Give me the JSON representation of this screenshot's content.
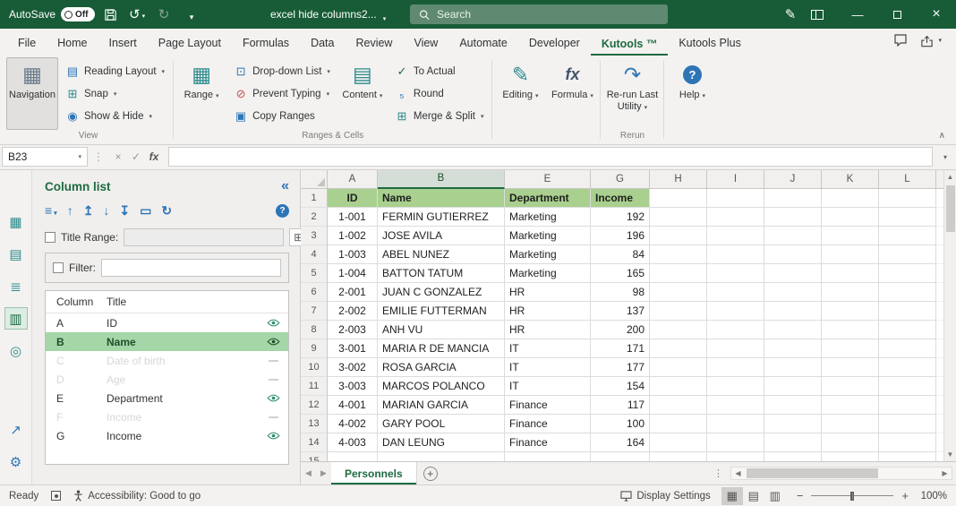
{
  "colors": {
    "titlebar_green": "#185c37",
    "accent_green": "#1e6b41",
    "header_fill_green": "#a9d08e",
    "selected_row_green": "#a4d6a7",
    "icon_blue": "#2e75b6",
    "icon_teal": "#2e8b8b"
  },
  "titlebar": {
    "autosave_label": "AutoSave",
    "autosave_state": "Off",
    "doc_title": "excel hide columns2...",
    "search_placeholder": "Search"
  },
  "ribbon_tabs": {
    "items": [
      "File",
      "Home",
      "Insert",
      "Page Layout",
      "Formulas",
      "Data",
      "Review",
      "View",
      "Automate",
      "Developer",
      "Kutools ™",
      "Kutools Plus"
    ],
    "active": "Kutools ™"
  },
  "ribbon": {
    "groups": [
      {
        "label": "View",
        "items": [
          {
            "type": "big",
            "label": "Navigation",
            "icon": "▦",
            "icon_color": "#6a7b8c",
            "selected": true,
            "caret": false
          },
          {
            "type": "col",
            "items": [
              {
                "label": "Reading Layout",
                "icon": "▤",
                "icon_color": "#2e75b6",
                "caret": true
              },
              {
                "label": "Snap",
                "icon": "⊞",
                "icon_color": "#2e8b8b",
                "caret": true
              },
              {
                "label": "Show & Hide",
                "icon": "◉",
                "icon_color": "#2e75b6",
                "caret": true
              }
            ]
          }
        ]
      },
      {
        "label": "Ranges & Cells",
        "items": [
          {
            "type": "big",
            "label": "Range",
            "icon": "▦",
            "icon_color": "#2e8b8b",
            "caret": true
          },
          {
            "type": "col",
            "items": [
              {
                "label": "Drop-down List",
                "icon": "⊡",
                "icon_color": "#2e75b6",
                "caret": true
              },
              {
                "label": "Prevent Typing",
                "icon": "⊘",
                "icon_color": "#c0504d",
                "caret": true
              },
              {
                "label": "Copy Ranges",
                "icon": "▣",
                "icon_color": "#2e75b6",
                "caret": false
              }
            ]
          },
          {
            "type": "big",
            "label": "Content",
            "icon": "▤",
            "icon_color": "#2e8b8b",
            "caret": true
          },
          {
            "type": "col",
            "items": [
              {
                "label": "To Actual",
                "icon": "✓",
                "icon_color": "#1e6b41",
                "caret": false
              },
              {
                "label": "Round",
                "icon": "₅",
                "icon_color": "#2e75b6",
                "caret": false
              },
              {
                "label": "Merge & Split",
                "icon": "⊞",
                "icon_color": "#2e8b8b",
                "caret": true
              }
            ]
          }
        ]
      },
      {
        "label": "",
        "items": [
          {
            "type": "big",
            "label": "Editing",
            "icon": "✎",
            "icon_color": "#2e8b8b",
            "caret": true
          },
          {
            "type": "big",
            "label": "Formula",
            "icon": "fx",
            "icon_color": "#44546a",
            "caret": true,
            "italic": true
          }
        ]
      },
      {
        "label": "Rerun",
        "items": [
          {
            "type": "big",
            "label": "Re-run Last Utility",
            "icon": "↷",
            "icon_color": "#2e75b6",
            "caret": true
          }
        ]
      },
      {
        "label": "",
        "items": [
          {
            "type": "big",
            "label": "Help",
            "icon": "?",
            "icon_color": "#ffffff",
            "icon_bg": "#2e75b6",
            "caret": true
          }
        ]
      }
    ]
  },
  "formula_bar": {
    "name_box": "B23",
    "fx_label": "fx"
  },
  "left_strip": {
    "top": [
      {
        "name": "navigation-pane-icon",
        "glyph": "▦"
      },
      {
        "name": "worksheet-list-icon",
        "glyph": "▤"
      },
      {
        "name": "resources-library-icon",
        "glyph": "≣"
      },
      {
        "name": "column-list-icon",
        "glyph": "▥",
        "active": true
      },
      {
        "name": "advanced-find-icon",
        "glyph": "◎"
      }
    ],
    "bottom": [
      {
        "name": "expand-pane-icon",
        "glyph": "↗"
      },
      {
        "name": "settings-gear-icon",
        "glyph": "⚙"
      }
    ]
  },
  "pane": {
    "title": "Column list",
    "collapse_glyph": "«",
    "toolbar": [
      {
        "name": "list-menu-icon",
        "glyph": "≡",
        "caret": true
      },
      {
        "name": "move-up-icon",
        "glyph": "↑"
      },
      {
        "name": "move-to-top-icon",
        "glyph": "↥"
      },
      {
        "name": "move-down-icon",
        "glyph": "↓"
      },
      {
        "name": "move-to-bottom-icon",
        "glyph": "↧"
      },
      {
        "name": "flip-icon",
        "glyph": "▭"
      },
      {
        "name": "refresh-icon",
        "glyph": "↻"
      }
    ],
    "help_glyph": "?",
    "title_range_label": "Title Range:",
    "filter_label": "Filter:",
    "list_headers": [
      "Column",
      "Title"
    ],
    "rows": [
      {
        "column": "A",
        "title": "ID",
        "visible": true,
        "selected": false
      },
      {
        "column": "B",
        "title": "Name",
        "visible": true,
        "selected": true
      },
      {
        "column": "C",
        "title": "Date of birth",
        "visible": false,
        "selected": false
      },
      {
        "column": "D",
        "title": "Age",
        "visible": false,
        "selected": false
      },
      {
        "column": "E",
        "title": "Department",
        "visible": true,
        "selected": false
      },
      {
        "column": "F",
        "title": "Income",
        "visible": false,
        "selected": false
      },
      {
        "column": "G",
        "title": "Income",
        "visible": true,
        "selected": false
      }
    ]
  },
  "sheet": {
    "selected_cell": "B23",
    "selected_column": "B",
    "columns": [
      "A",
      "B",
      "E",
      "G",
      "H",
      "I",
      "J",
      "K",
      "L"
    ],
    "header_row": {
      "A": "ID",
      "B": "Name",
      "E": "Department",
      "G": "Income"
    },
    "rows": [
      {
        "A": "1-001",
        "B": "FERMIN GUTIERREZ",
        "E": "Marketing",
        "G": "192"
      },
      {
        "A": "1-002",
        "B": "JOSE AVILA",
        "E": "Marketing",
        "G": "196"
      },
      {
        "A": "1-003",
        "B": "ABEL NUNEZ",
        "E": "Marketing",
        "G": "84"
      },
      {
        "A": "1-004",
        "B": "BATTON TATUM",
        "E": "Marketing",
        "G": "165"
      },
      {
        "A": "2-001",
        "B": "JUAN C GONZALEZ",
        "E": "HR",
        "G": "98"
      },
      {
        "A": "2-002",
        "B": "EMILIE FUTTERMAN",
        "E": "HR",
        "G": "137"
      },
      {
        "A": "2-003",
        "B": "ANH VU",
        "E": "HR",
        "G": "200"
      },
      {
        "A": "3-001",
        "B": "MARIA R DE MANCIA",
        "E": "IT",
        "G": "171"
      },
      {
        "A": "3-002",
        "B": "ROSA GARCIA",
        "E": "IT",
        "G": "177"
      },
      {
        "A": "3-003",
        "B": "MARCOS POLANCO",
        "E": "IT",
        "G": "154"
      },
      {
        "A": "4-001",
        "B": "MARIAN GARCIA",
        "E": "Finance",
        "G": "117"
      },
      {
        "A": "4-002",
        "B": "GARY POOL",
        "E": "Finance",
        "G": "100"
      },
      {
        "A": "4-003",
        "B": "DAN LEUNG",
        "E": "Finance",
        "G": "164"
      }
    ]
  },
  "tabs_row": {
    "tabs": [
      {
        "label": "Personnels",
        "active": true
      }
    ]
  },
  "status_bar": {
    "ready": "Ready",
    "accessibility": "Accessibility: Good to go",
    "display_settings": "Display Settings",
    "zoom": "100%"
  }
}
